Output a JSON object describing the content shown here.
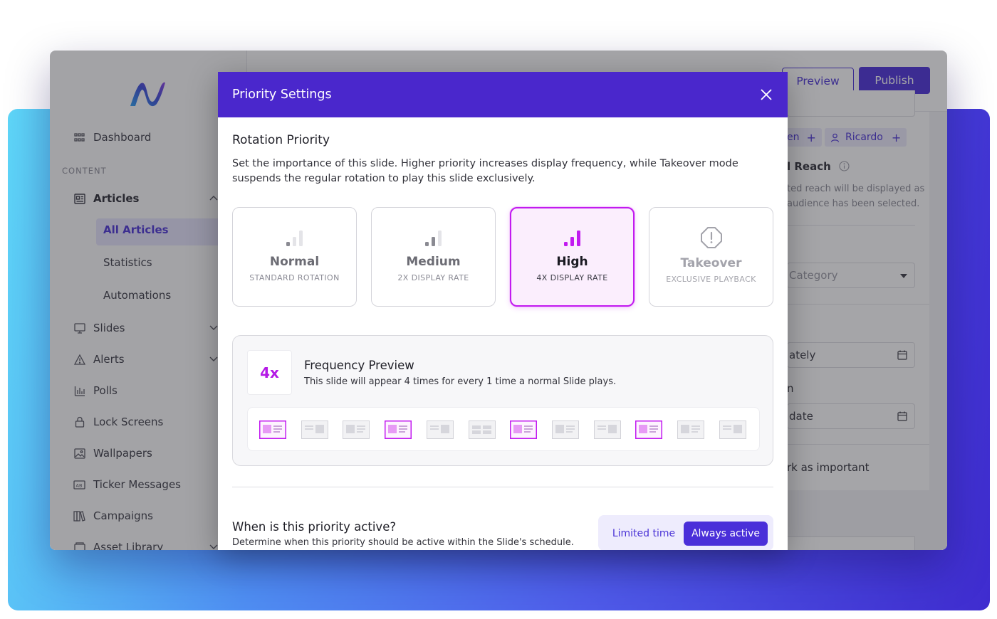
{
  "sidebar": {
    "section_label": "CONTENT",
    "items": [
      {
        "label": "Dashboard",
        "icon": "dashboard-icon"
      },
      {
        "label": "Articles",
        "icon": "articles-icon"
      },
      {
        "label": "Slides",
        "icon": "slides-icon"
      },
      {
        "label": "Alerts",
        "icon": "alert-icon"
      },
      {
        "label": "Polls",
        "icon": "polls-icon"
      },
      {
        "label": "Lock Screens",
        "icon": "lock-icon"
      },
      {
        "label": "Wallpapers",
        "icon": "wallpaper-icon"
      },
      {
        "label": "Ticker Messages",
        "icon": "ticker-icon"
      },
      {
        "label": "Campaigns",
        "icon": "campaigns-icon"
      },
      {
        "label": "Asset Library",
        "icon": "asset-library-icon"
      }
    ],
    "articles_sub": [
      "All Articles",
      "Statistics",
      "Automations"
    ]
  },
  "topbar": {
    "preview_label": "Preview",
    "publish_label": "Publish"
  },
  "background_panel": {
    "chip1": "en",
    "chip2": "Ricardo",
    "reach_label": "l Reach",
    "reach_desc_1": "ted reach will be displayed as",
    "reach_desc_2": "audience has been selected.",
    "category_placeholder": "Category",
    "start_value": "ately",
    "end_label": "n",
    "end_value": "date",
    "important_label": "rk as important"
  },
  "modal": {
    "title": "Priority Settings",
    "rotation_heading": "Rotation Priority",
    "rotation_desc": "Set the importance of this slide. Higher priority increases display frequency, while Takeover mode suspends the regular rotation to play this slide exclusively.",
    "options": [
      {
        "name": "Normal",
        "sub": "STANDARD ROTATION"
      },
      {
        "name": "Medium",
        "sub": "2X DISPLAY RATE"
      },
      {
        "name": "High",
        "sub": "4X DISPLAY RATE"
      },
      {
        "name": "Takeover",
        "sub": "EXCLUSIVE PLAYBACK"
      }
    ],
    "selected_option": "High",
    "frequency": {
      "badge": "4x",
      "title": "Frequency Preview",
      "desc": "This slide will appear 4 times for every 1 time a normal Slide plays."
    },
    "when_heading": "When is this priority active?",
    "when_desc": "Determine when this priority should be active within the Slide's schedule.",
    "toggle": {
      "limited": "Limited time",
      "always": "Always active",
      "selected": "Always active"
    }
  },
  "colors": {
    "brand": "#4a27cc",
    "primary_button": "#4a2fd9",
    "accent_magenta": "#c21af0"
  }
}
